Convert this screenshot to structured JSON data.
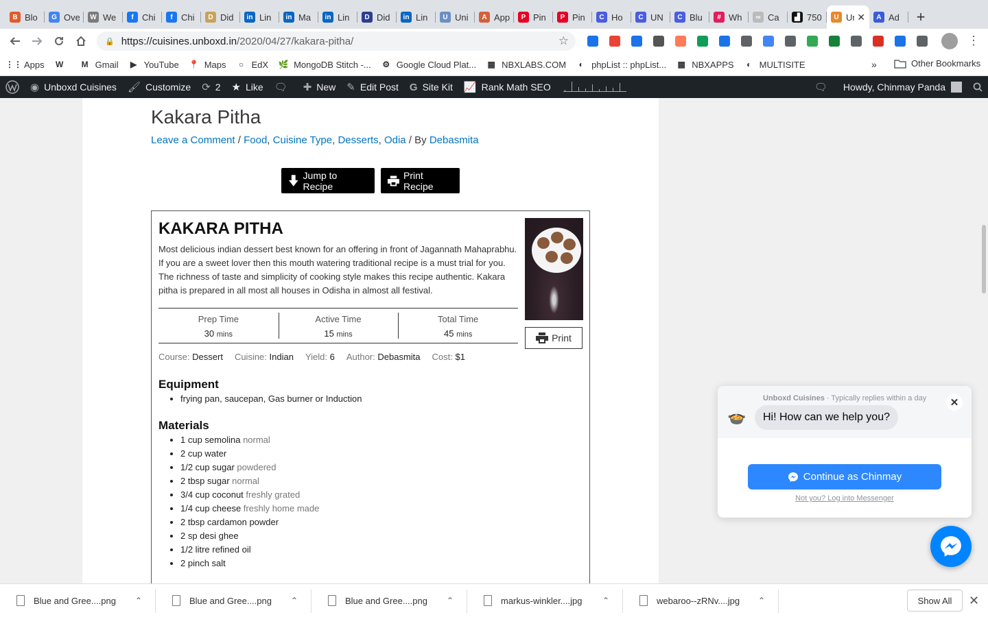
{
  "browser": {
    "tabs": [
      {
        "label": "Blo",
        "color": "#e25b2b",
        "glyph": "B"
      },
      {
        "label": "Ove",
        "color": "#4285f4",
        "glyph": "G"
      },
      {
        "label": "We",
        "color": "#7b7b7b",
        "glyph": "W"
      },
      {
        "label": "Chi",
        "color": "#1877f2",
        "glyph": "f"
      },
      {
        "label": "Chi",
        "color": "#1877f2",
        "glyph": "f"
      },
      {
        "label": "Did",
        "color": "#c8a25a",
        "glyph": "D"
      },
      {
        "label": "Lin",
        "color": "#0a66c2",
        "glyph": "in"
      },
      {
        "label": "Ma",
        "color": "#0a66c2",
        "glyph": "in"
      },
      {
        "label": "Lin",
        "color": "#0a66c2",
        "glyph": "in"
      },
      {
        "label": "Did",
        "color": "#2d3e8f",
        "glyph": "D"
      },
      {
        "label": "Lin",
        "color": "#0a66c2",
        "glyph": "in"
      },
      {
        "label": "Uni",
        "color": "#6b8fc4",
        "glyph": "U"
      },
      {
        "label": "App",
        "color": "#d4603c",
        "glyph": "A"
      },
      {
        "label": "Pin",
        "color": "#e60023",
        "glyph": "P"
      },
      {
        "label": "Pin",
        "color": "#e60023",
        "glyph": "P"
      },
      {
        "label": "Ho",
        "color": "#4a5de0",
        "glyph": "C"
      },
      {
        "label": "UN",
        "color": "#4a5de0",
        "glyph": "C"
      },
      {
        "label": "Blu",
        "color": "#4a5de0",
        "glyph": "C"
      },
      {
        "label": "Wh",
        "color": "#e01e5a",
        "glyph": "#"
      },
      {
        "label": "Ca",
        "color": "#bbbbbb",
        "glyph": "∞"
      },
      {
        "label": "750",
        "color": "#111111",
        "glyph": "▟"
      }
    ],
    "active_tab": {
      "label": "Unboxd Cuisines",
      "color": "#e8892b",
      "glyph": "U",
      "close": "✕"
    },
    "extra_tab": {
      "label": "Ad",
      "color": "#3b5bdb",
      "glyph": "A"
    },
    "new_tab": "+",
    "url_host": "https://cuisines.unboxd.in",
    "url_path": "/2020/04/27/kakara-pitha/",
    "extensions": [
      "#1a73e8",
      "#ea4335",
      "#1a73e8",
      "#555555",
      "#ff7a59",
      "#0f9d58",
      "#1a73e8",
      "#5f6368",
      "#4285f4",
      "#5f6368",
      "#34a853",
      "#188038",
      "#5f6368",
      "#d93025",
      "#1a73e8",
      "#5f6368"
    ],
    "bookmarks": [
      {
        "label": "Apps",
        "icon": "⋮⋮"
      },
      {
        "label": "",
        "icon": "W"
      },
      {
        "label": "Gmail",
        "icon": "M"
      },
      {
        "label": "YouTube",
        "icon": "▶"
      },
      {
        "label": "Maps",
        "icon": "📍"
      },
      {
        "label": "EdX",
        "icon": "○"
      },
      {
        "label": "MongoDB Stitch -...",
        "icon": "🌿"
      },
      {
        "label": "Google Cloud Plat...",
        "icon": "⚙"
      },
      {
        "label": "NBXLABS.COM",
        "icon": "▦"
      },
      {
        "label": "phpList :: phpList...",
        "icon": "◐"
      },
      {
        "label": "NBXAPPS",
        "icon": "▦"
      },
      {
        "label": "MULTISITE",
        "icon": "◐"
      }
    ],
    "bookmarks_more": "»",
    "other_bookmarks": "Other Bookmarks"
  },
  "adminbar": {
    "site": "Unboxd Cuisines",
    "customize": "Customize",
    "updates": "2",
    "like": "Like",
    "new": "New",
    "edit_post": "Edit Post",
    "site_kit": "Site Kit",
    "rank_math": "Rank Math SEO",
    "howdy": "Howdy, Chinmay Panda"
  },
  "post": {
    "title": "Kakara Pitha",
    "meta_comment": "Leave a Comment",
    "meta_sep1": " / ",
    "meta_categories": [
      "Food",
      "Cuisine Type",
      "Desserts",
      "Odia"
    ],
    "meta_by": " / By ",
    "meta_author": "Debasmita",
    "jump_label": "Jump to Recipe",
    "print_label": "Print Recipe"
  },
  "recipe": {
    "name": "KAKARA PITHA",
    "summary": "Most delicious indian dessert best known for an offering in front of Jagannath Mahaprabhu. If you are a sweet lover then this mouth watering traditional recipe is a must trial for you. The richness of taste and simplicity of cooking style makes this recipe authentic. Kakara pitha is prepared in all most all houses in Odisha in almost all festival.",
    "print": "Print",
    "times": [
      {
        "label": "Prep Time",
        "value": "30",
        "unit": "mins"
      },
      {
        "label": "Active Time",
        "value": "15",
        "unit": "mins"
      },
      {
        "label": "Total Time",
        "value": "45",
        "unit": "mins"
      }
    ],
    "meta": [
      {
        "label": "Course:",
        "value": "Dessert"
      },
      {
        "label": "Cuisine:",
        "value": "Indian"
      },
      {
        "label": "Yield:",
        "value": "6"
      },
      {
        "label": "Author:",
        "value": "Debasmita"
      },
      {
        "label": "Cost:",
        "value": "$1"
      }
    ],
    "equipment_heading": "Equipment",
    "equipment": [
      "frying pan, saucepan, Gas burner or Induction"
    ],
    "materials_heading": "Materials",
    "materials": [
      {
        "item": "1 cup semolina",
        "note": "normal"
      },
      {
        "item": "2 cup water",
        "note": ""
      },
      {
        "item": "1/2 cup sugar",
        "note": "powdered"
      },
      {
        "item": "2 tbsp sugar",
        "note": "normal"
      },
      {
        "item": "3/4 cup coconut",
        "note": "freshly grated"
      },
      {
        "item": "1/4 cup cheese",
        "note": "freshly home made"
      },
      {
        "item": "2 tbsp cardamon powder",
        "note": ""
      },
      {
        "item": "2 sp desi ghee",
        "note": ""
      },
      {
        "item": "1/2 litre refined oil",
        "note": ""
      },
      {
        "item": "2 pinch salt",
        "note": ""
      }
    ]
  },
  "chat": {
    "page_name": "Unboxd Cuisines",
    "reply_time": " · Typically replies within a day",
    "greeting": "Hi! How can we help you?",
    "continue": "Continue as Chinmay",
    "not_you": "Not you? Log into Messenger"
  },
  "downloads": {
    "items": [
      "Blue and Gree....png",
      "Blue and Gree....png",
      "Blue and Gree....png",
      "markus-winkler....jpg",
      "webaroo--zRNv....jpg"
    ],
    "show_all": "Show All"
  }
}
